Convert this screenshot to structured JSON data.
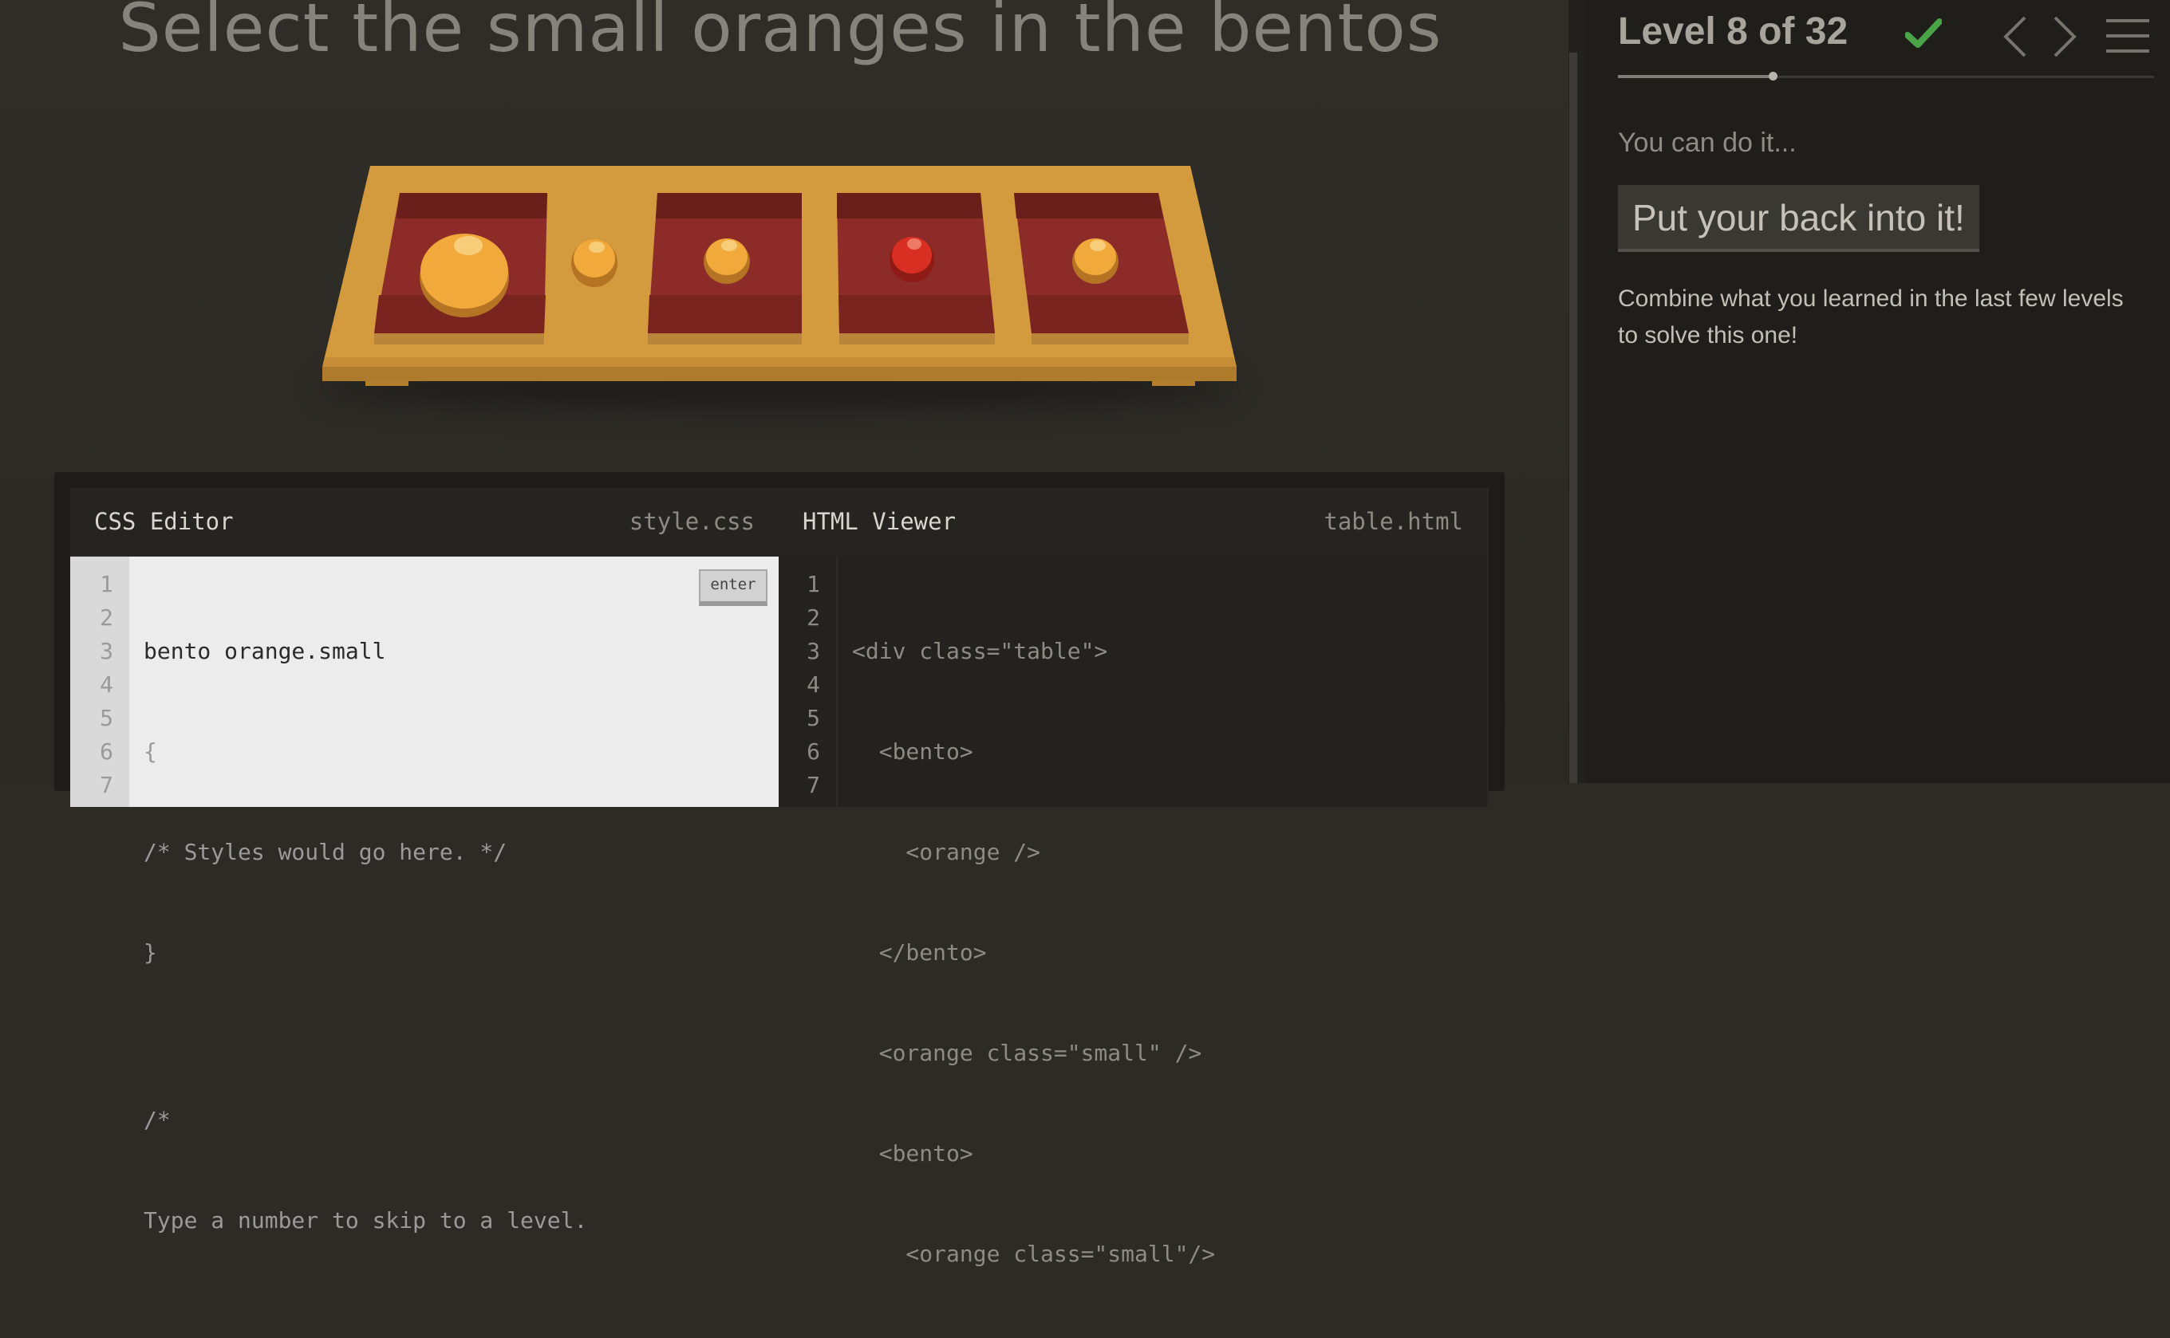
{
  "instruction": "Select the small oranges in the bentos",
  "colors": {
    "table": "#d39b3e",
    "bento": "#8f2e2a",
    "orange": "#f0a53a",
    "apple": "#d92e22",
    "check": "#4aa447"
  },
  "table_items": [
    {
      "type": "bento",
      "contents": "orange"
    },
    {
      "type": "orange",
      "size": "small"
    },
    {
      "type": "bento",
      "contents": "orange.small"
    },
    {
      "type": "bento",
      "contents": "apple.small"
    },
    {
      "type": "bento",
      "contents": "orange.small"
    }
  ],
  "css_editor": {
    "title": "CSS Editor",
    "filename": "style.css",
    "input_value": "bento orange.small",
    "enter_label": "enter",
    "line_numbers": [
      "1",
      "2",
      "3",
      "4",
      "5",
      "6",
      "7"
    ],
    "lines": [
      "{",
      "/* Styles would go here. */",
      "}",
      "",
      "/*",
      "Type a number to skip to a level."
    ]
  },
  "html_viewer": {
    "title": "HTML Viewer",
    "filename": "table.html",
    "line_numbers": [
      "1",
      "2",
      "3",
      "4",
      "5",
      "6",
      "7"
    ],
    "lines": [
      "<div class=\"table\">",
      "  <bento>",
      "    <orange />",
      "  </bento>",
      "  <orange class=\"small\" />",
      "  <bento>",
      "    <orange class=\"small\"/>"
    ]
  },
  "sidebar": {
    "level_title": "Level 8 of 32",
    "level_current": 8,
    "level_total": 32,
    "completed": true,
    "hint_label": "You can do it...",
    "cheer": "Put your back into it!",
    "hint_text": "Combine what you learned in the last few levels to solve this one!"
  }
}
